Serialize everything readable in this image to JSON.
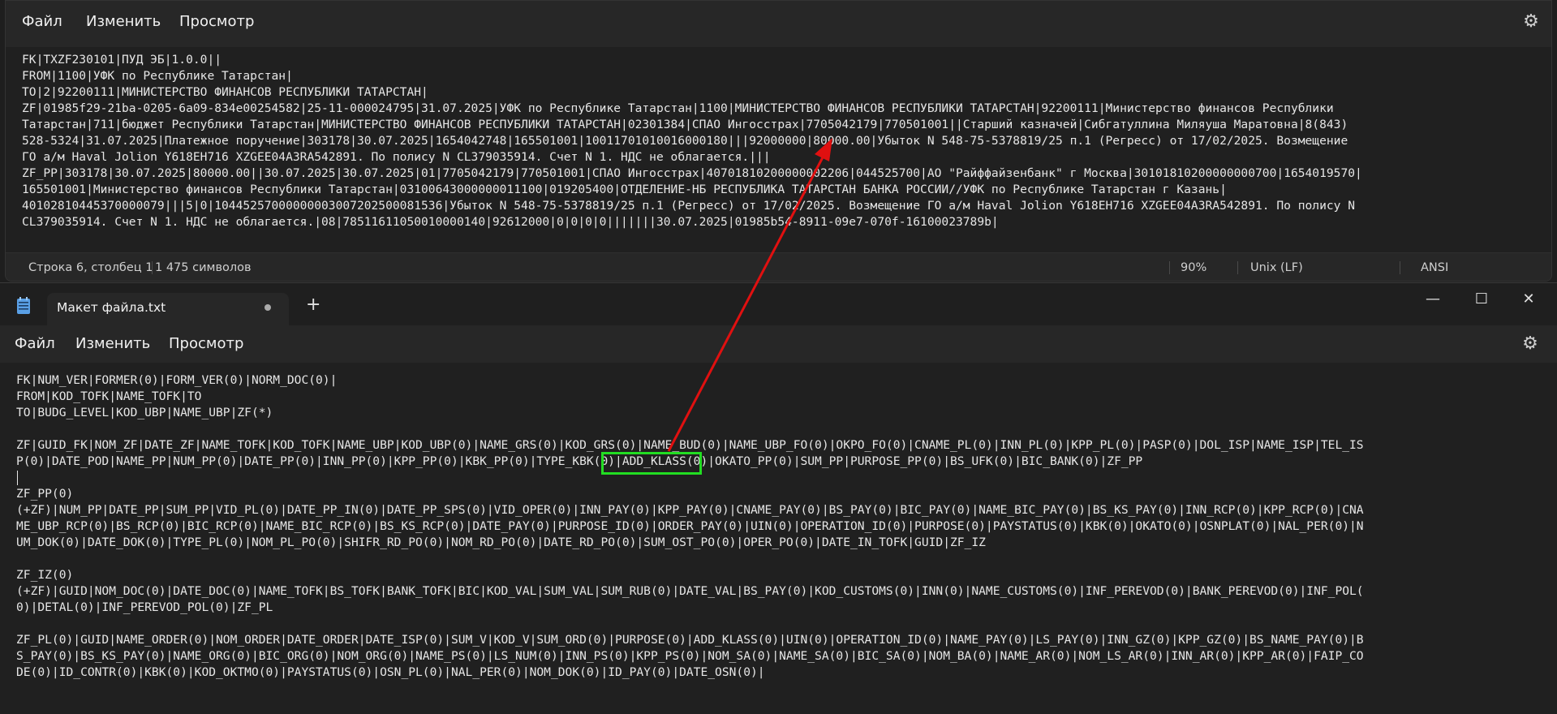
{
  "top_window": {
    "menu": [
      "Файл",
      "Изменить",
      "Просмотр"
    ],
    "lines": [
      "FK|TXZF230101|ПУД ЭБ|1.0.0||",
      "FROM|1100|УФК по Республике Татарстан|",
      "TO|2|92200111|МИНИСТЕРСТВО ФИНАНСОВ РЕСПУБЛИКИ ТАТАРСТАН|",
      "ZF|01985f29-21ba-0205-6a09-834e00254582|25-11-000024795|31.07.2025|УФК по Республике Татарстан|1100|МИНИСТЕРСТВО ФИНАНСОВ РЕСПУБЛИКИ ТАТАРСТАН|92200111|Министерство финансов Республики",
      "Татарстан|711|бюджет Республики Татарстан|МИНИСТЕРСТВО ФИНАНСОВ РЕСПУБЛИКИ ТАТАРСТАН|02301384|СПАО Ингосстрах|7705042179|770501001||Старший казначей|Сибгатуллина Миляуша Маратовна|8(843)",
      "528-5324|31.07.2025|Платежное поручение|303178|30.07.2025|1654042748|165501001|10011701010016000180|||92000000|80000.00|Убыток N 548-75-5378819/25 п.1 (Регресс) от 17/02/2025. Возмещение",
      "ГО а/м Haval Jolion Y618EH716 XZGEE04A3RA542891. По полису N CL379035914. Счет N 1. НДС не облагается.|||",
      "ZF_PP|303178|30.07.2025|80000.00||30.07.2025|30.07.2025|01|7705042179|770501001|СПАО Ингосстрах|40701810200000002206|044525700|АО \"Райффайзенбанк\" г Москва|30101810200000000700|1654019570|",
      "165501001|Министерство финансов Республики Татарстан|03100643000000011100|019205400|ОТДЕЛЕНИЕ-НБ РЕСПУБЛИКА ТАТАРСТАН БАНКА РОССИИ//УФК по Республике Татарстан г Казань|",
      "40102810445370000079|||5|0|10445257000000003007202500081536|Убыток N 548-75-5378819/25 п.1 (Регресс) от 17/02/2025. Возмещение ГО а/м Haval Jolion Y618EH716 XZGEE04A3RA542891. По полису N",
      "CL379035914. Счет N 1. НДС не облагается.|08|78511611050010000140|92612000|0|0|0|0|||||||30.07.2025|01985b54-8911-09e7-070f-16100023789b|"
    ],
    "status": {
      "position": "Строка 6, столбец 1",
      "chars": "1 475 символов",
      "zoom": "90%",
      "line_endings": "Unix (LF)",
      "encoding": "ANSI"
    }
  },
  "bottom_window": {
    "tab_title": "Макет файла.txt",
    "new_tab": "+",
    "controls": {
      "minimize": "—",
      "maximize": "☐",
      "close": "✕"
    },
    "menu": [
      "Файл",
      "Изменить",
      "Просмотр"
    ],
    "lines": [
      "FK|NUM_VER|FORMER(0)|FORM_VER(0)|NORM_DOC(0)|",
      "FROM|KOD_TOFK|NAME_TOFK|TO",
      "TO|BUDG_LEVEL|KOD_UBP|NAME_UBP|ZF(*)",
      "",
      "ZF|GUID_FK|NOM_ZF|DATE_ZF|NAME_TOFK|KOD_TOFK|NAME_UBP|KOD_UBP(0)|NAME_GRS(0)|KOD_GRS(0)|NAME_BUD(0)|NAME_UBP_FO(0)|OKPO_FO(0)|CNAME_PL(0)|INN_PL(0)|KPP_PL(0)|PASP(0)|DOL_ISP|NAME_ISP|TEL_IS",
      "P(0)|DATE_POD|NAME_PP|NUM_PP(0)|DATE_PP(0)|INN_PP(0)|KPP_PP(0)|KBK_PP(0)|TYPE_KBK(0)|ADD_KLASS(0)|OKATO_PP(0)|SUM_PP|PURPOSE_PP(0)|BS_UFK(0)|BIC_BANK(0)|ZF_PP",
      "",
      "ZF_PP(0)",
      "(+ZF)|NUM_PP|DATE_PP|SUM_PP|VID_PL(0)|DATE_PP_IN(0)|DATE_PP_SPS(0)|VID_OPER(0)|INN_PAY(0)|KPP_PAY(0)|CNAME_PAY(0)|BS_PAY(0)|BIC_PAY(0)|NAME_BIC_PAY(0)|BS_KS_PAY(0)|INN_RCP(0)|KPP_RCP(0)|CNA",
      "ME_UBP_RCP(0)|BS_RCP(0)|BIC_RCP(0)|NAME_BIC_RCP(0)|BS_KS_RCP(0)|DATE_PAY(0)|PURPOSE_ID(0)|ORDER_PAY(0)|UIN(0)|OPERATION_ID(0)|PURPOSE(0)|PAYSTATUS(0)|KBK(0)|OKATO(0)|OSNPLAT(0)|NAL_PER(0)|N",
      "UM_DOK(0)|DATE_DOK(0)|TYPE_PL(0)|NOM_PL_PO(0)|SHIFR_RD_PO(0)|NOM_RD_PO(0)|DATE_RD_PO(0)|SUM_OST_PO(0)|OPER_PO(0)|DATE_IN_TOFK|GUID|ZF_IZ",
      "",
      "ZF_IZ(0)",
      "(+ZF)|GUID|NOM_DOC(0)|DATE_DOC(0)|NAME_TOFK|BS_TOFK|BANK_TOFK|BIC|KOD_VAL|SUM_VAL|SUM_RUB(0)|DATE_VAL|BS_PAY(0)|KOD_CUSTOMS(0)|INN(0)|NAME_CUSTOMS(0)|INF_PEREVOD(0)|BANK_PEREVOD(0)|INF_POL(",
      "0)|DETAL(0)|INF_PEREVOD_POL(0)|ZF_PL",
      "",
      "ZF_PL(0)|GUID|NAME_ORDER(0)|NOM_ORDER|DATE_ORDER|DATE_ISP(0)|SUM_V|KOD_V|SUM_ORD(0)|PURPOSE(0)|ADD_KLASS(0)|UIN(0)|OPERATION_ID(0)|NAME_PAY(0)|LS_PAY(0)|INN_GZ(0)|KPP_GZ(0)|BS_NAME_PAY(0)|B",
      "S_PAY(0)|BS_KS_PAY(0)|NAME_ORG(0)|BIC_ORG(0)|NOM_ORG(0)|NAME_PS(0)|LS_NUM(0)|INN_PS(0)|KPP_PS(0)|NOM_SA(0)|NAME_SA(0)|BIC_SA(0)|NOM_BA(0)|NAME_AR(0)|NOM_LS_AR(0)|INN_AR(0)|KPP_AR(0)|FAIP_CO",
      "DE(0)|ID_CONTR(0)|KBK(0)|KOD_OKTMO(0)|PAYSTATUS(0)|OSN_PL(0)|NAL_PER(0)|NOM_DOK(0)|ID_PAY(0)|DATE_OSN(0)|"
    ]
  },
  "annotation": {
    "highlight_color": "#22dd22",
    "arrow_color": "#e01010"
  }
}
